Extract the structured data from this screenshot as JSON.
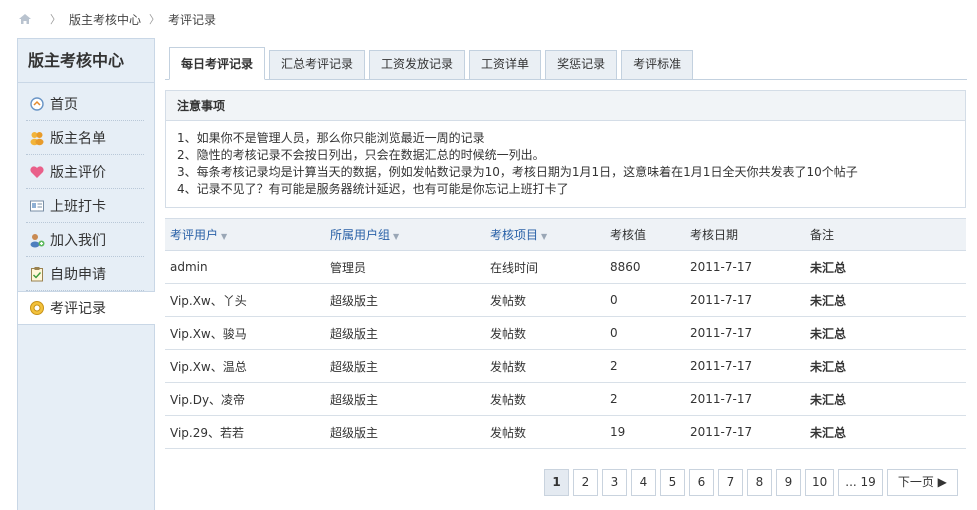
{
  "breadcrumb": {
    "items": [
      "版主考核中心",
      "考评记录"
    ]
  },
  "sidebar": {
    "title": "版主考核中心",
    "items": [
      {
        "label": "首页",
        "icon": "home-icon"
      },
      {
        "label": "版主名单",
        "icon": "users-icon"
      },
      {
        "label": "版主评价",
        "icon": "heart-icon"
      },
      {
        "label": "上班打卡",
        "icon": "card-icon"
      },
      {
        "label": "加入我们",
        "icon": "add-user-icon"
      },
      {
        "label": "自助申请",
        "icon": "clipboard-icon"
      },
      {
        "label": "考评记录",
        "icon": "record-icon"
      }
    ],
    "active_index": 6
  },
  "tabs": [
    "每日考评记录",
    "汇总考评记录",
    "工资发放记录",
    "工资详单",
    "奖惩记录",
    "考评标准"
  ],
  "notice": {
    "title": "注意事项",
    "lines": [
      "1、如果你不是管理人员，那么你只能浏览最近一周的记录",
      "2、隐性的考核记录不会按日列出，只会在数据汇总的时候统一列出。",
      "3、每条考核记录均是计算当天的数据，例如发帖数记录为10，考核日期为1月1日，这意味着在1月1日全天你共发表了10个帖子",
      "4、记录不见了？有可能是服务器统计延迟，也有可能是你忘记上班打卡了"
    ]
  },
  "table": {
    "headers": [
      "考评用户",
      "所属用户组",
      "考核项目",
      "考核值",
      "考核日期",
      "备注"
    ],
    "rows": [
      [
        "admin",
        "管理员",
        "在线时间",
        "8860",
        "2011-7-17",
        "未汇总"
      ],
      [
        "Vip.Xw、丫头",
        "超级版主",
        "发帖数",
        "0",
        "2011-7-17",
        "未汇总"
      ],
      [
        "Vip.Xw、骏马",
        "超级版主",
        "发帖数",
        "0",
        "2011-7-17",
        "未汇总"
      ],
      [
        "Vip.Xw、温总",
        "超级版主",
        "发帖数",
        "2",
        "2011-7-17",
        "未汇总"
      ],
      [
        "Vip.Dy、凌帝",
        "超级版主",
        "发帖数",
        "2",
        "2011-7-17",
        "未汇总"
      ],
      [
        "Vip.29、若若",
        "超级版主",
        "发帖数",
        "19",
        "2011-7-17",
        "未汇总"
      ]
    ]
  },
  "pager": {
    "pages": [
      "1",
      "2",
      "3",
      "4",
      "5",
      "6",
      "7",
      "8",
      "9",
      "10",
      "... 19"
    ],
    "current": "1",
    "next_label": "下一页 ▶"
  },
  "colors": {
    "accent": "#2b62a8",
    "sidebar_bg": "#e6eef6",
    "border": "#c9d7e6"
  }
}
